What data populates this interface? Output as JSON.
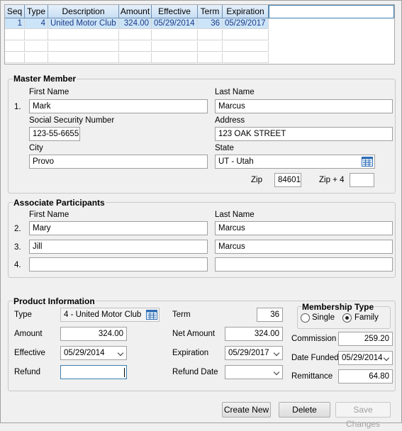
{
  "grid": {
    "columns": [
      "Seq",
      "Type",
      "Description",
      "Amount",
      "Effective",
      "Term",
      "Expiration"
    ],
    "rows": [
      {
        "seq": "1",
        "type": "4",
        "description": "United Motor Club",
        "amount": "324.00",
        "effective": "05/29/2014",
        "term": "36",
        "expiration": "05/29/2017"
      }
    ]
  },
  "master_member": {
    "title": "Master Member",
    "first_name_label": "First Name",
    "last_name_label": "Last Name",
    "index": "1.",
    "first_name": "Mark",
    "last_name": "Marcus",
    "ssn_label": "Social Security Number",
    "ssn": "123-55-6655",
    "address_label": "Address",
    "address": "123 OAK STREET",
    "city_label": "City",
    "city": "Provo",
    "state_label": "State",
    "state": "UT - Utah",
    "zip_label": "Zip",
    "zip": "84601",
    "zip4_label": "Zip + 4",
    "zip4": ""
  },
  "associates": {
    "title": "Associate Participants",
    "first_name_label": "First Name",
    "last_name_label": "Last Name",
    "rows": [
      {
        "index": "2.",
        "first": "Mary",
        "last": "Marcus"
      },
      {
        "index": "3.",
        "first": "Jill",
        "last": "Marcus"
      },
      {
        "index": "4.",
        "first": "",
        "last": ""
      }
    ]
  },
  "product": {
    "title": "Product Information",
    "type_label": "Type",
    "type": "4 - United Motor Club",
    "amount_label": "Amount",
    "amount": "324.00",
    "effective_label": "Effective",
    "effective": "05/29/2014",
    "refund_label": "Refund",
    "refund": "",
    "term_label": "Term",
    "term": "36",
    "net_amount_label": "Net Amount",
    "net_amount": "324.00",
    "expiration_label": "Expiration",
    "expiration": "05/29/2017",
    "refund_date_label": "Refund Date",
    "refund_date": "",
    "membership_title": "Membership Type",
    "single_label": "Single",
    "family_label": "Family",
    "membership_selected": "Family",
    "commission_label": "Commission",
    "commission": "259.20",
    "date_funded_label": "Date Funded",
    "date_funded": "05/29/2014",
    "remittance_label": "Remittance",
    "remittance": "64.80"
  },
  "buttons": {
    "create_new": "Create New",
    "delete": "Delete",
    "save_changes": "Save Changes"
  },
  "colors": {
    "grid_header": "#c9dff5",
    "selected_row": "#cce4f7",
    "window_bg": "#f0f0f0"
  },
  "icons": [
    "calendar-list-icon",
    "chevron-down-icon",
    "radio-icon"
  ]
}
